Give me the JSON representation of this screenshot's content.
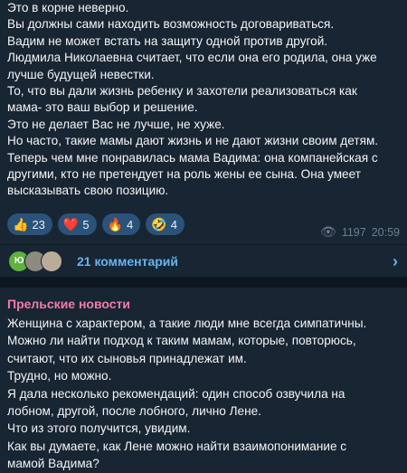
{
  "message1": {
    "lines": [
      "Это  в корне неверно.",
      "Вы должны сами находить возможность договариваться.",
      "Вадим не может встать на защиту одной против другой.",
      "Людмила Николаевна считает, что если она его родила, она уже",
      "лучше будущей невестки.",
      "То, что вы дали жизнь ребенку и захотели реализоваться как",
      "мама- это ваш выбор и решение.",
      "Это не делает Вас не лучше, не хуже.",
      "Но часто, такие мамы дают жизнь и не дают жизни своим детям.",
      "Теперь чем мне понравилась мама Вадима: она компанейская с",
      "другими, кто не претендует на роль жены ее сына. Она умеет",
      "высказывать свою позицию."
    ],
    "reactions": [
      {
        "emoji": "👍",
        "count": "23"
      },
      {
        "emoji": "❤️",
        "count": "5"
      },
      {
        "emoji": "🔥",
        "count": "4"
      },
      {
        "emoji": "🤣",
        "count": "4"
      }
    ],
    "views": "1197",
    "time": "20:59"
  },
  "comments": {
    "avatar_letter": "Ю",
    "label": "21 комментарий"
  },
  "message2": {
    "author": "Прельские новости",
    "lines": [
      "Женщина с характером, а такие люди мне всегда симпатичны.",
      "Можно ли найти подход к таким мамам, которые, повторюсь,",
      "считают, что их сыновья принадлежат им.",
      "Трудно, но можно.",
      "Я дала несколько рекомендаций: один способ озвучила на",
      "лобном, другой, после лобного, лично Лене.",
      "Что из этого получится, увидим.",
      "Как вы думаете, как Лене можно найти взаимопонимание с",
      "мамой Вадима?"
    ]
  },
  "colors": {
    "background": "#0e1621",
    "bubble": "#182533",
    "link": "#64b5ef",
    "author": "#f27ca5",
    "reaction_bg": "#2b5278"
  }
}
